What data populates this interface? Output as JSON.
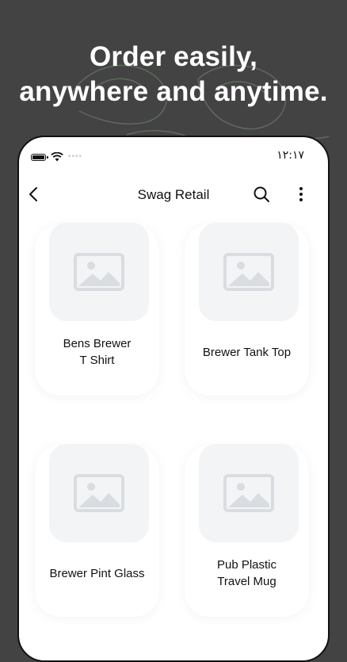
{
  "promo": {
    "line1": "Order easily,",
    "line2": "anywhere and anytime."
  },
  "status_bar": {
    "time": "١٢:١٧",
    "icons": [
      "battery-icon",
      "wifi-icon",
      "signal-dots-icon"
    ]
  },
  "header": {
    "title": "Swag Retail",
    "back_icon": "chevron-left-icon",
    "search_icon": "search-icon",
    "menu_icon": "more-vertical-icon"
  },
  "products": [
    {
      "name": "Bens Brewer T Shirt",
      "line1": "Bens Brewer",
      "line2": "T Shirt",
      "image": "image-placeholder-icon"
    },
    {
      "name": "Brewer Tank Top",
      "line1": "Brewer Tank Top",
      "line2": "",
      "image": "image-placeholder-icon"
    },
    {
      "name": "Brewer Pint Glass",
      "line1": "Brewer Pint Glass",
      "line2": "",
      "image": "image-placeholder-icon"
    },
    {
      "name": "Pub Plastic Travel Mug",
      "line1": "Pub Plastic",
      "line2": "Travel Mug",
      "image": "image-placeholder-icon"
    }
  ],
  "colors": {
    "background": "#434343",
    "card": "#ffffff",
    "thumb": "#f3f4f6",
    "placeholder_icon": "#d9dce0",
    "text": "#111111"
  }
}
